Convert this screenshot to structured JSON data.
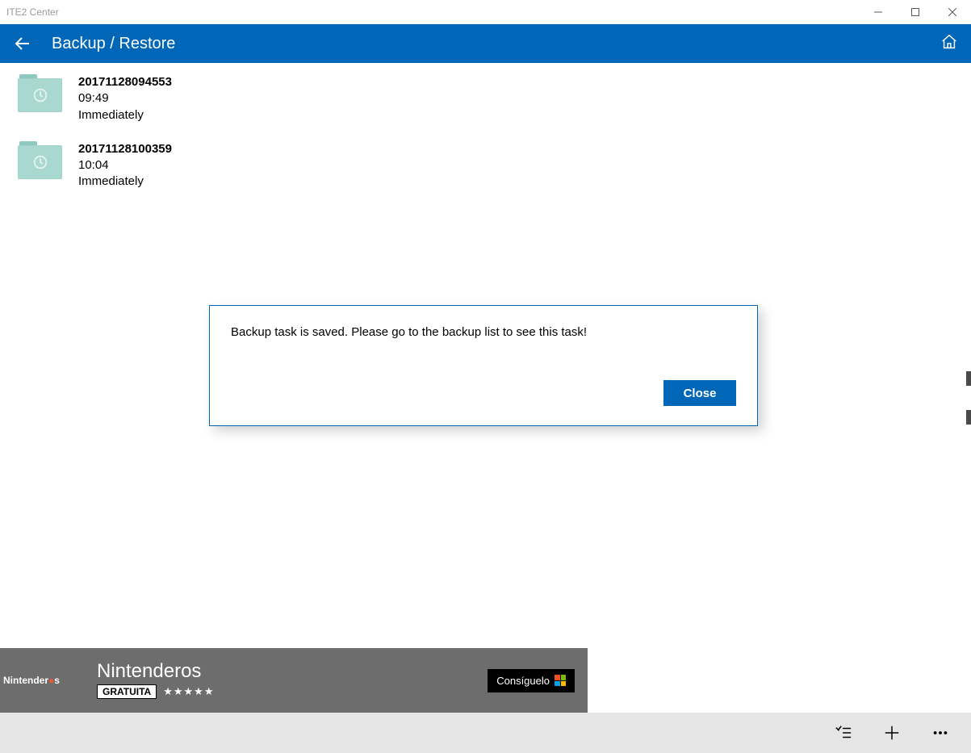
{
  "window": {
    "title": "ITE2 Center"
  },
  "header": {
    "title": "Backup / Restore"
  },
  "backups": [
    {
      "name": "20171128094553",
      "time": "09:49",
      "mode": "Immediately"
    },
    {
      "name": "20171128100359",
      "time": "10:04",
      "mode": "Immediately"
    }
  ],
  "dialog": {
    "message": "Backup task is saved. Please go to the backup list to see this task!",
    "close_label": "Close"
  },
  "ad": {
    "brand_prefix": "Nintender",
    "brand_suffix": "s",
    "title": "Nintenderos",
    "badge": "GRATUITA",
    "stars": "★★★★★",
    "cta": "Consíguelo"
  }
}
